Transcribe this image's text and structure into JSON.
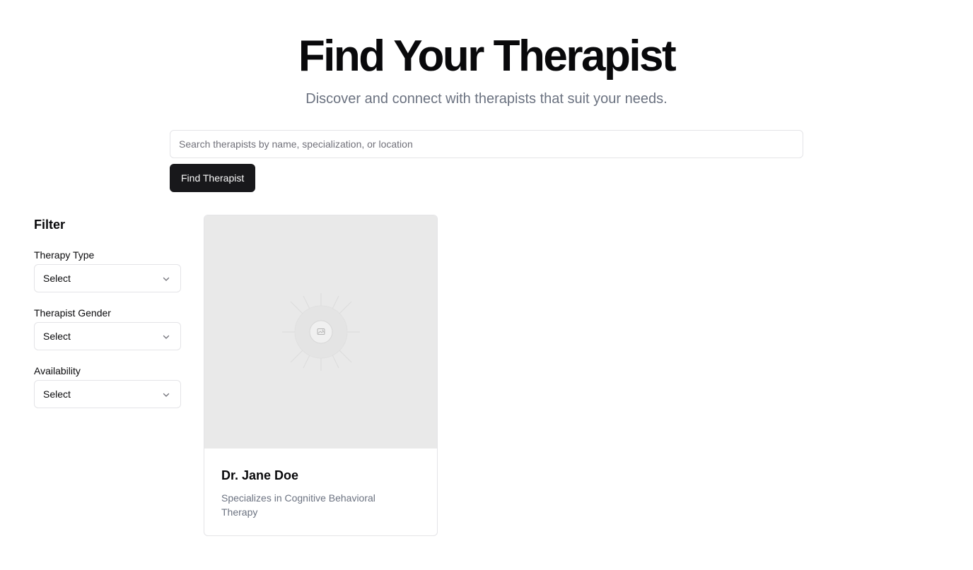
{
  "hero": {
    "title": "Find Your Therapist",
    "subtitle": "Discover and connect with therapists that suit your needs."
  },
  "search": {
    "placeholder": "Search therapists by name, specialization, or location",
    "value": "",
    "button_label": "Find Therapist"
  },
  "filters": {
    "title": "Filter",
    "groups": [
      {
        "label": "Therapy Type",
        "selected": "Select",
        "icon": "chevron-down-icon"
      },
      {
        "label": "Therapist Gender",
        "selected": "Select",
        "icon": "chevron-down-icon"
      },
      {
        "label": "Availability",
        "selected": "Select",
        "icon": "chevron-down-icon"
      }
    ]
  },
  "results": [
    {
      "name": "Dr. Jane Doe",
      "description": "Specializes in Cognitive Behavioral Therapy",
      "image_icon": "image-placeholder-icon"
    }
  ],
  "colors": {
    "primary_button": "#18181b",
    "muted_text": "#6b7280",
    "border": "#e4e4e7",
    "image_placeholder": "#e9e9e9"
  }
}
